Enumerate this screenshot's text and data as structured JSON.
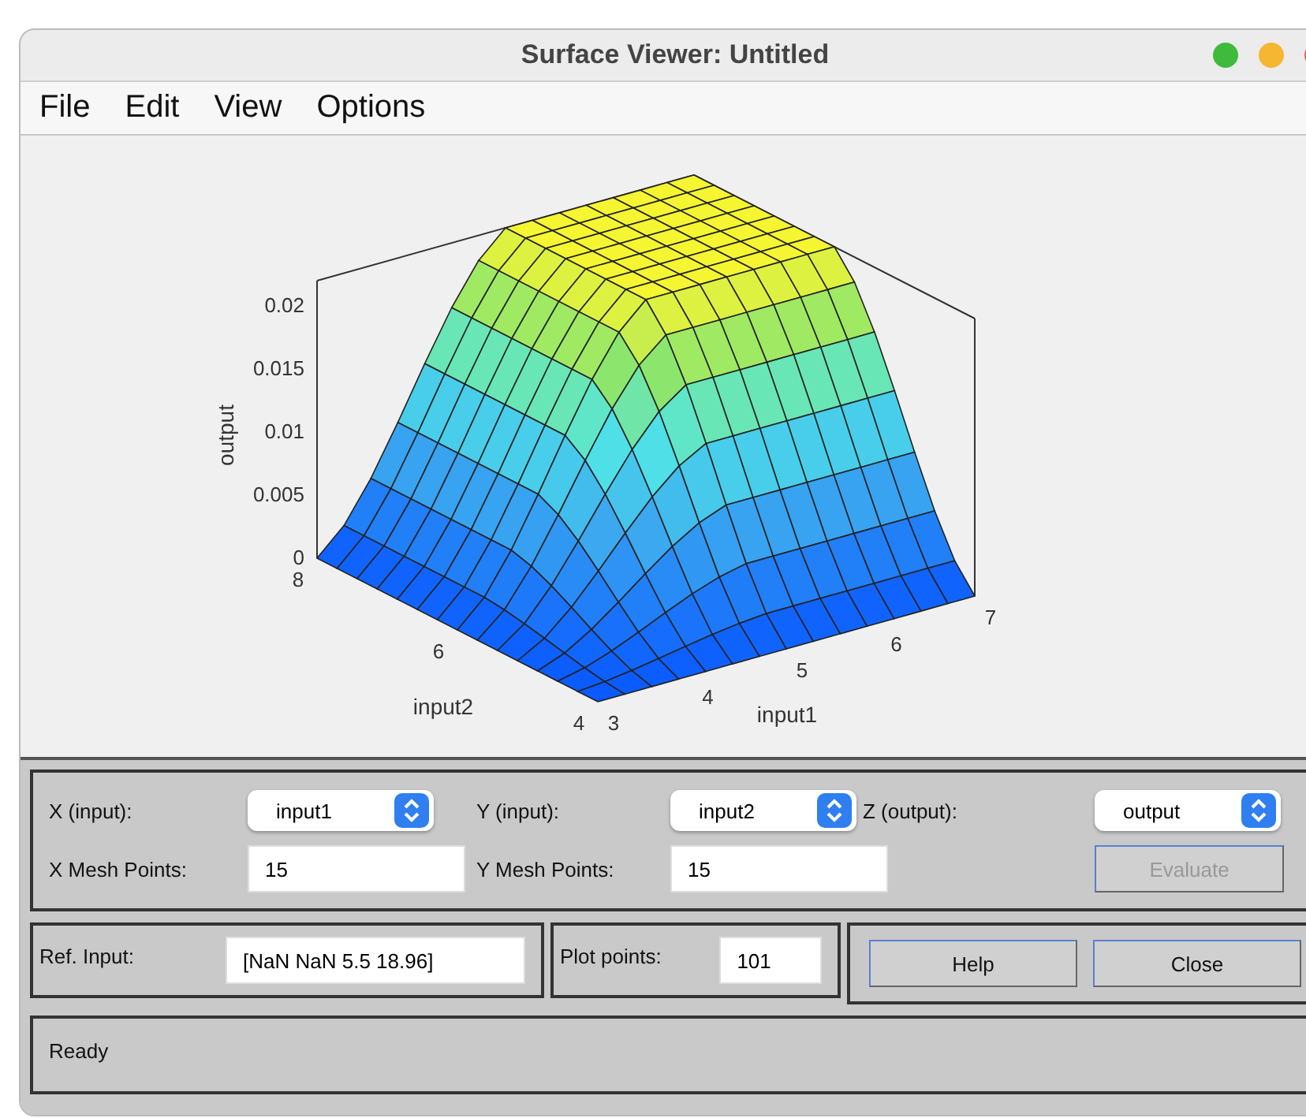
{
  "window": {
    "title": "Surface Viewer: Untitled"
  },
  "menu": [
    "File",
    "Edit",
    "View",
    "Options"
  ],
  "plot": {
    "zlabel": "output",
    "xlabel": "input1",
    "ylabel": "input2",
    "zticks": [
      "0.02",
      "0.015",
      "0.01",
      "0.005",
      "0"
    ],
    "xticks": [
      "3",
      "4",
      "5",
      "6",
      "7"
    ],
    "yticks": [
      "4",
      "6",
      "8"
    ]
  },
  "axes": [
    {
      "label": "X (input):",
      "value": "input1"
    },
    {
      "label": "Y (input):",
      "value": "input2"
    },
    {
      "label": "Z (output):",
      "value": "output"
    }
  ],
  "mesh": [
    {
      "label": "X Mesh Points:",
      "value": "15"
    },
    {
      "label": "Y Mesh Points:",
      "value": "15"
    }
  ],
  "evaluate": {
    "label": "Evaluate",
    "disabled": true
  },
  "ref_input": {
    "label": "Ref. Input:",
    "value": "[NaN NaN 5.5 18.96]"
  },
  "plot_points": {
    "label": "Plot points:",
    "value": "101"
  },
  "buttons": [
    "Help",
    "Close"
  ],
  "status_bar": "Ready"
}
